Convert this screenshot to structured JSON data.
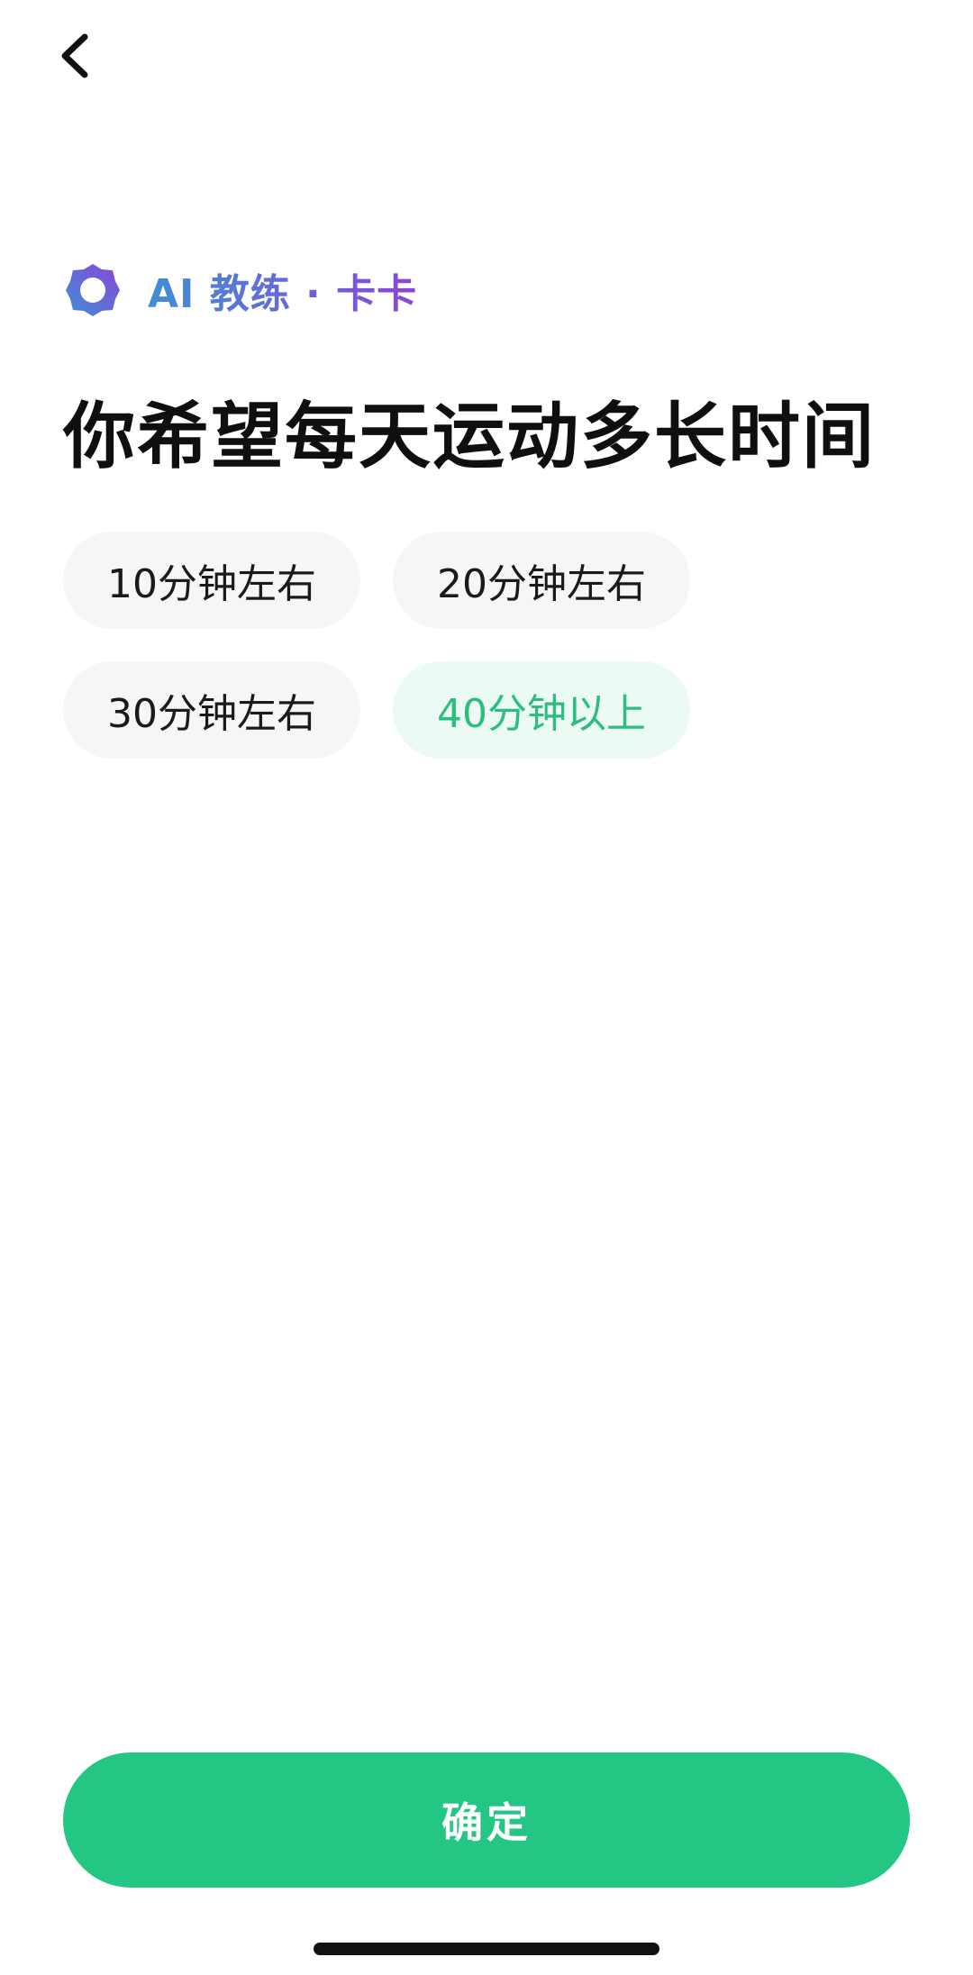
{
  "header": {
    "back_icon": "chevron-left-icon"
  },
  "coach": {
    "logo_icon": "ai-coach-logo-icon",
    "label": "AI 教练 · 卡卡",
    "gradient_start": "#3f8fd6",
    "gradient_end": "#8b45d8"
  },
  "main": {
    "title": "你希望每天运动多长时间",
    "options": [
      {
        "label": "10分钟左右",
        "selected": false
      },
      {
        "label": "20分钟左右",
        "selected": false
      },
      {
        "label": "30分钟左右",
        "selected": false
      },
      {
        "label": "40分钟以上",
        "selected": true
      }
    ]
  },
  "footer": {
    "confirm_label": "确定"
  },
  "colors": {
    "accent": "#24c684",
    "selected_text": "#2dbe7f",
    "selected_bg": "#ebfaf2",
    "chip_bg": "#f6f6f6"
  }
}
